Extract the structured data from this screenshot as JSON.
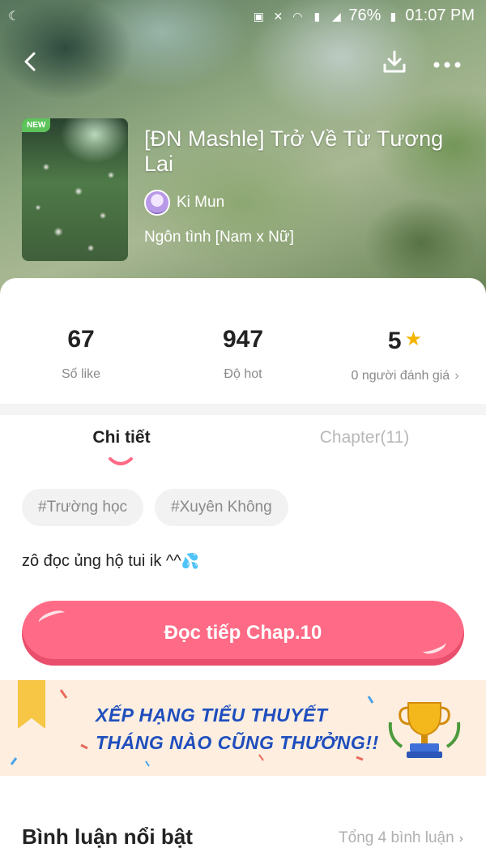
{
  "status_bar": {
    "left_icon": "moon-icon",
    "battery": "76%",
    "time": "01:07 PM"
  },
  "story": {
    "badge": "NEW",
    "title": "[ĐN Mashle] Trở Về Từ Tương Lai",
    "author": "Ki Mun",
    "genre": "Ngôn tình [Nam x Nữ]"
  },
  "stats": {
    "likes": {
      "value": "67",
      "label": "Số like"
    },
    "hot": {
      "value": "947",
      "label": "Độ hot"
    },
    "rating": {
      "value": "5",
      "label": "0 người đánh giá"
    }
  },
  "tabs": [
    {
      "label": "Chi tiết",
      "active": true
    },
    {
      "label": "Chapter(11)",
      "active": false
    }
  ],
  "tags": [
    "#Trường học",
    "#Xuyên Không"
  ],
  "description": {
    "text": "zô đọc ủng hộ tui ik ^^",
    "emoji": "💦"
  },
  "read_button": "Đọc tiếp Chap.10",
  "banner": {
    "line1": "XẾP HẠNG TIỂU THUYẾT",
    "line2": "THÁNG NÀO CŨNG THƯỞNG!!"
  },
  "comments": {
    "title": "Bình luận nổi bật",
    "link": "Tổng 4 bình luận"
  },
  "colors": {
    "accent": "#ff6b86",
    "banner_text": "#1f4ebd",
    "star": "#f5b400"
  }
}
